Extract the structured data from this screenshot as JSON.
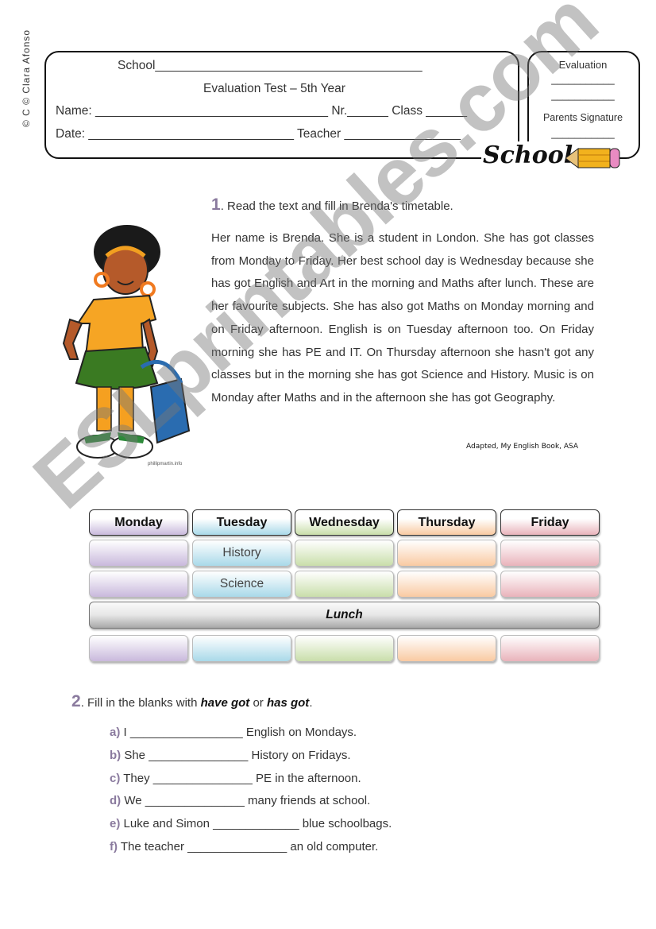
{
  "copyright": "© C  © Clara Afonso",
  "header": {
    "school": "School_______________________________________",
    "title": "Evaluation Test – 5th Year",
    "name_line": "Name: __________________________________ Nr.______ Class ______",
    "date_line": "Date: ______________________________ Teacher _________________",
    "evaluation_label": "Evaluation",
    "eval_blank1": "___________",
    "eval_blank2": "___________",
    "parents_label": "Parents Signature",
    "parents_blank": "___________",
    "logo_text": "School"
  },
  "exercise1": {
    "number": "1",
    "instruction": ". Read the text and fill in Brenda's timetable.",
    "text": "Her name is Brenda. She is a student in London. She has got classes from Monday to Friday. Her best school day is Wednesday because she has got English and Art in the morning and Maths after lunch. These are her favourite subjects. She has also got Maths on Monday morning and on Friday afternoon. English is on Tuesday afternoon too. On Friday morning she has PE and IT. On Thursday afternoon she hasn't got any classes but in the morning she has got Science and History. Music is on Monday after Maths and in the afternoon she has got Geography.",
    "credit": "Adapted, My English Book, ASA",
    "illustration_credit": "phillipmartin.info"
  },
  "timetable": {
    "days": [
      "Monday",
      "Tuesday",
      "Wednesday",
      "Thursday",
      "Friday"
    ],
    "colors": [
      "#c9b9dc",
      "#a9d9e9",
      "#c9deaa",
      "#f9caa2",
      "#e9b3bb"
    ],
    "rows": [
      [
        "",
        "History",
        "",
        "",
        ""
      ],
      [
        "",
        "Science",
        "",
        "",
        ""
      ],
      [
        "",
        "",
        "",
        "",
        ""
      ]
    ],
    "lunch": "Lunch"
  },
  "exercise2": {
    "number": "2",
    "instruction_pre": ". Fill in the blanks with ",
    "bold1": "have got",
    "mid": " or ",
    "bold2": "has got",
    "end": ".",
    "items": [
      {
        "letter": "a)",
        "text": " I _________________ English on Mondays."
      },
      {
        "letter": "b)",
        "text": " She _______________ History on Fridays."
      },
      {
        "letter": "c)",
        "text": " They _______________ PE in the afternoon."
      },
      {
        "letter": "d)",
        "text": " We _______________ many friends at school."
      },
      {
        "letter": "e)",
        "text": " Luke and Simon _____________ blue schoolbags."
      },
      {
        "letter": "f)",
        "text": " The teacher _______________ an old computer."
      }
    ]
  },
  "watermark": "ESLprintables.com"
}
